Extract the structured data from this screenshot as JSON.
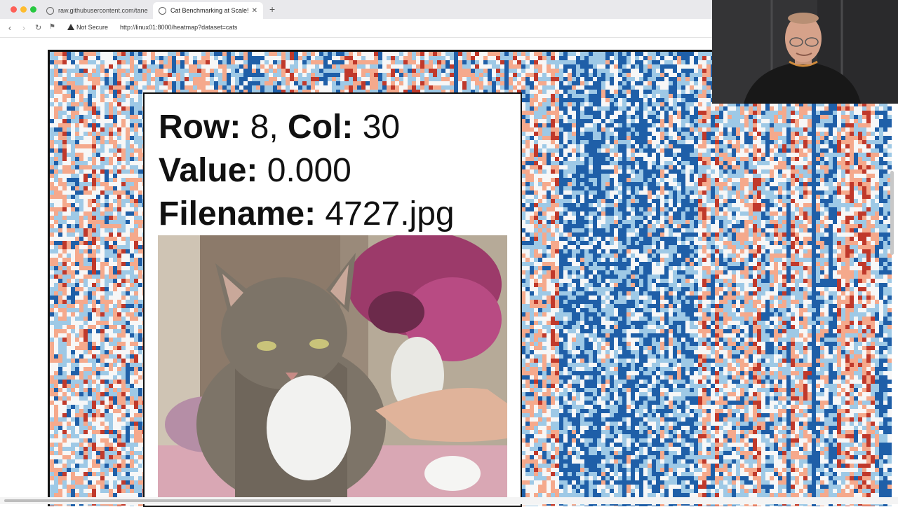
{
  "browser": {
    "tabs": [
      {
        "title": "raw.githubusercontent.com/tane",
        "active": false
      },
      {
        "title": "Cat Benchmarking at Scale!",
        "active": true
      }
    ],
    "security_label": "Not Secure",
    "url": "http://linux01:8000/heatmap?dataset=cats"
  },
  "tooltip": {
    "row_label": "Row:",
    "row_value": "8",
    "col_label": "Col:",
    "col_value": "30",
    "value_label": "Value:",
    "value_value": "0.000",
    "filename_label": "Filename:",
    "filename_value": "4727.jpg"
  },
  "chart_data": {
    "type": "heatmap",
    "colormap": [
      "#c0392b",
      "#f5a98c",
      "#f7f7f7",
      "#9ec9e6",
      "#1f5fa8"
    ],
    "hovered_cell": {
      "row": 8,
      "col": 30,
      "value": 0.0
    }
  }
}
